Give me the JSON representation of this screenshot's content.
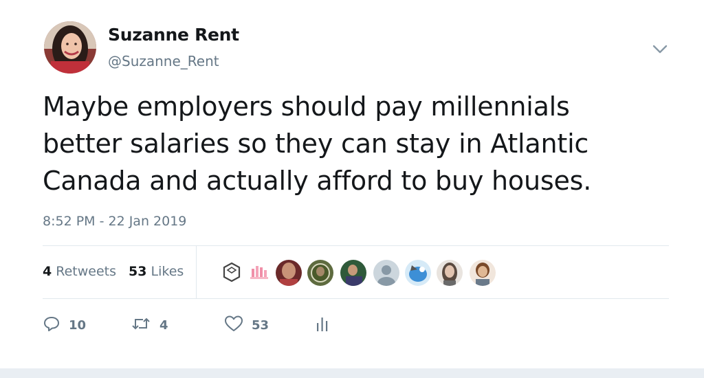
{
  "tweet": {
    "author_name": "Suzanne Rent",
    "author_handle": "@Suzanne_Rent",
    "text": "Maybe employers should pay millennials better salaries so they can stay in Atlantic Canada and actually afford to buy houses.",
    "timestamp": "8:52 PM - 22 Jan 2019"
  },
  "stats": {
    "retweets_count": "4",
    "retweets_label": "Retweets",
    "likes_count": "53",
    "likes_label": "Likes"
  },
  "actions": {
    "reply_count": "10",
    "retweet_count": "4",
    "like_count": "53"
  },
  "colors": {
    "muted_text": "#657786",
    "primary_text": "#14171a",
    "divider": "#e1e8ed"
  },
  "icons": [
    "chevron-down-icon",
    "reply-icon",
    "retweet-icon",
    "like-icon",
    "analytics-icon"
  ]
}
